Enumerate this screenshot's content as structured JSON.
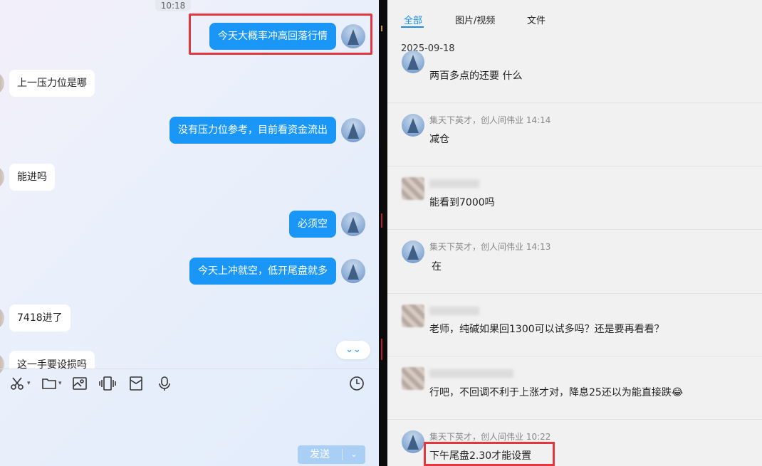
{
  "chat": {
    "top_time": "10:18",
    "messages": [
      {
        "side": "out",
        "text": "今天大概率冲高回落行情"
      },
      {
        "side": "in",
        "text": "上一压力位是哪"
      },
      {
        "side": "out",
        "text": "没有压力位参考，目前看资金流出"
      },
      {
        "side": "in",
        "text": "能进吗"
      },
      {
        "side": "out",
        "text": "必须空"
      },
      {
        "side": "out",
        "text": "今天上冲就空，低开尾盘就多"
      },
      {
        "side": "in",
        "text": "7418进了"
      },
      {
        "side": "in",
        "text": "这一手要设损吗"
      }
    ],
    "scroll_down_glyph": "⌄⌄",
    "send_label": "发送",
    "send_dropdown_glyph": "⌄"
  },
  "toolbar": {
    "icons": [
      "scissors-icon",
      "folder-icon",
      "image-icon",
      "vibrate-icon",
      "envelope-icon",
      "microphone-icon",
      "clock-icon"
    ]
  },
  "history": {
    "tabs": [
      "全部",
      "图片/视频",
      "文件"
    ],
    "active_tab": "全部",
    "date": "2025-09-18",
    "messages": [
      {
        "sender": "",
        "time": "",
        "text": "两百多点的还要 什么"
      },
      {
        "sender": "集天下英才，创人间伟业",
        "time": "14:14",
        "text": "减仓"
      },
      {
        "sender": "",
        "time": "",
        "text": "能看到7000吗"
      },
      {
        "sender": "集天下英才，创人间伟业",
        "time": "14:13",
        "text": "在"
      },
      {
        "sender": "",
        "time": "",
        "text": "老师，纯碱如果回1300可以试多吗？还是要再看看？"
      },
      {
        "sender": "",
        "time": "",
        "text": "行吧，不回调不利于上涨才对，降息25还以为能直接跌😂"
      },
      {
        "sender": "集天下英才，创人间伟业",
        "time": "10:22",
        "text": "下午尾盘2.30才能设置"
      }
    ]
  },
  "colors": {
    "bubble_out": "#1a96f7",
    "highlight": "#e2373f",
    "tab_active": "#1a8cf0"
  }
}
